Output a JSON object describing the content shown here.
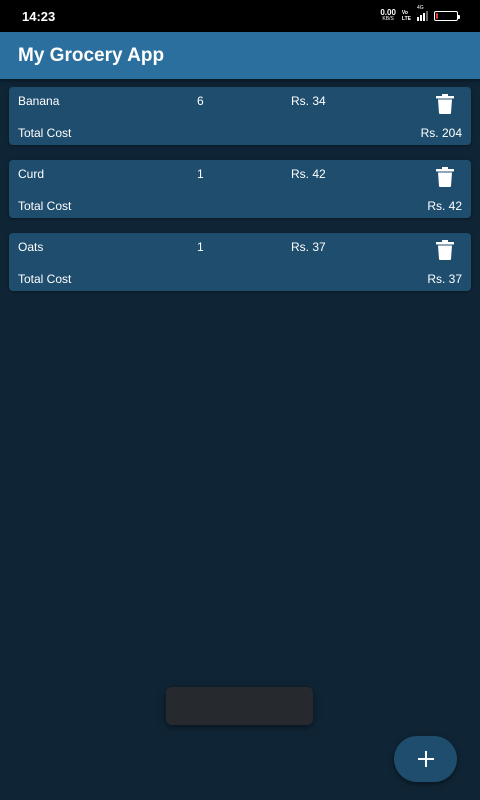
{
  "status_bar": {
    "time": "14:23",
    "net_speed": "0.00",
    "net_unit": "KB/S",
    "volte_top": "Vo",
    "volte_bottom": "LTE",
    "network": "4G",
    "battery_level": 0.12,
    "battery_color": "#e53935"
  },
  "app_bar": {
    "title": "My Grocery App",
    "color": "#2a6f9e"
  },
  "items": [
    {
      "name": "Banana",
      "qty": "6",
      "price": "Rs. 34",
      "total_label": "Total Cost",
      "total": "Rs. 204",
      "icon": "trash-icon"
    },
    {
      "name": "Curd",
      "qty": "1",
      "price": "Rs. 42",
      "total_label": "Total Cost",
      "total": "Rs. 42",
      "icon": "trash-icon"
    },
    {
      "name": "Oats",
      "qty": "1",
      "price": "Rs. 37",
      "total_label": "Total Cost",
      "total": "Rs. 37",
      "icon": "trash-icon"
    }
  ],
  "fab": {
    "icon": "plus-icon"
  },
  "colors": {
    "background": "#0f2536",
    "card": "#1f4d6e",
    "toast": "#262a2e"
  }
}
